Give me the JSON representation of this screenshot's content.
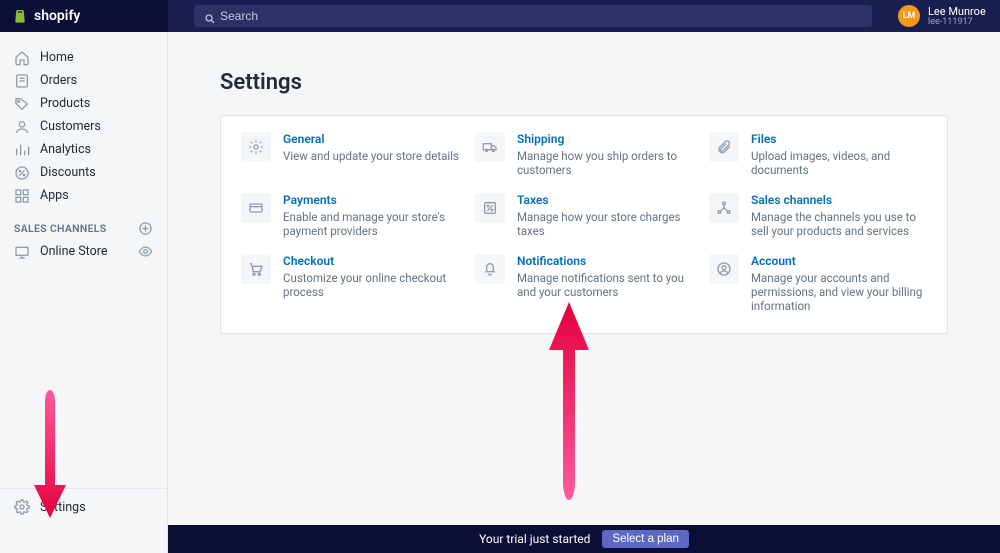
{
  "brand": {
    "name": "shopify"
  },
  "search": {
    "placeholder": "Search"
  },
  "user": {
    "initials": "LM",
    "name": "Lee Munroe",
    "subtext": "lee-111917"
  },
  "sidebar": {
    "items": [
      {
        "label": "Home"
      },
      {
        "label": "Orders"
      },
      {
        "label": "Products"
      },
      {
        "label": "Customers"
      },
      {
        "label": "Analytics"
      },
      {
        "label": "Discounts"
      },
      {
        "label": "Apps"
      }
    ],
    "sales_channels_header": "SALES CHANNELS",
    "channels": [
      {
        "label": "Online Store"
      }
    ],
    "settings_label": "Settings"
  },
  "page": {
    "title": "Settings"
  },
  "tiles": [
    {
      "title": "General",
      "desc": "View and update your store details"
    },
    {
      "title": "Shipping",
      "desc": "Manage how you ship orders to customers"
    },
    {
      "title": "Files",
      "desc": "Upload images, videos, and documents"
    },
    {
      "title": "Payments",
      "desc": "Enable and manage your store's payment providers"
    },
    {
      "title": "Taxes",
      "desc": "Manage how your store charges taxes"
    },
    {
      "title": "Sales channels",
      "desc": "Manage the channels you use to sell your products and services"
    },
    {
      "title": "Checkout",
      "desc": "Customize your online checkout process"
    },
    {
      "title": "Notifications",
      "desc": "Manage notifications sent to you and your customers"
    },
    {
      "title": "Account",
      "desc": "Manage your accounts and permissions, and view your billing information"
    }
  ],
  "bottombar": {
    "text": "Your trial just started",
    "button": "Select a plan"
  }
}
